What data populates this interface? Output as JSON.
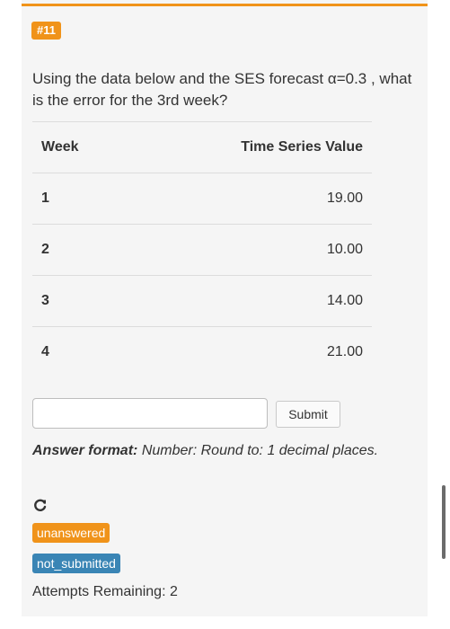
{
  "question": {
    "number": "#11",
    "prompt": "Using the data below and the SES forecast α=0.3 , what is the error for the 3rd week?"
  },
  "table": {
    "headers": [
      "Week",
      "Time Series Value"
    ],
    "rows": [
      [
        "1",
        "19.00"
      ],
      [
        "2",
        "10.00"
      ],
      [
        "3",
        "14.00"
      ],
      [
        "4",
        "21.00"
      ]
    ]
  },
  "answer": {
    "value": "",
    "submit_label": "Submit",
    "format_label": "Answer format:",
    "format_text": "Number: Round to: 1 decimal places."
  },
  "status": {
    "reset_icon": "reset-icon",
    "answered_badge": "unanswered",
    "submitted_badge": "not_submitted",
    "attempts": "Attempts Remaining: 2"
  },
  "colors": {
    "accent": "#f0931a",
    "info": "#3a85b5"
  }
}
